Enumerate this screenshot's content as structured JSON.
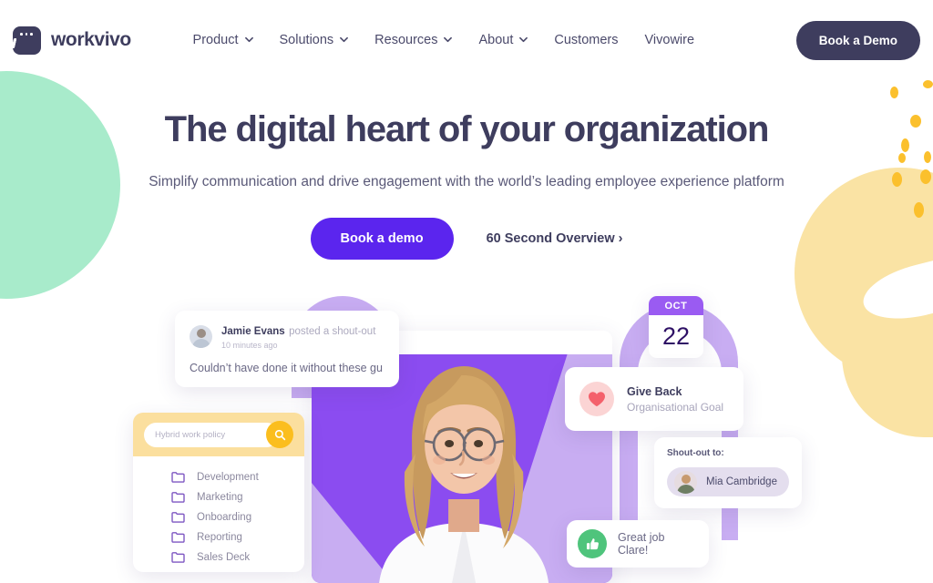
{
  "brand": {
    "name": "workvivo",
    "logo_icon": "workvivo-logo-icon",
    "logo_color": "#3E3D5E"
  },
  "nav": {
    "items": [
      {
        "label": "Product",
        "has_dropdown": true
      },
      {
        "label": "Solutions",
        "has_dropdown": true
      },
      {
        "label": "Resources",
        "has_dropdown": true
      },
      {
        "label": "About",
        "has_dropdown": true
      },
      {
        "label": "Customers",
        "has_dropdown": false
      },
      {
        "label": "Vivowire",
        "has_dropdown": false
      }
    ],
    "cta_label": "Book a Demo",
    "cta_color": "#3E3D5E"
  },
  "hero": {
    "headline": "The digital heart of your organization",
    "subheadline": "Simplify communication and drive engagement with the world’s leading employee experience platform",
    "primary_cta": "Book a demo",
    "primary_cta_color": "#5B25EE",
    "secondary_cta": "60 Second Overview ›"
  },
  "composition": {
    "shoutout_card": {
      "author": "Jamie Evans",
      "action": "posted a shout-out",
      "timestamp": "10 minutes ago",
      "body": "Couldn’t have done it without these gu",
      "avatar_icon": "user-avatar"
    },
    "search_card": {
      "search_placeholder": "Hybrid work policy",
      "search_icon": "search-icon",
      "search_button_color": "#FBBE1E",
      "header_color": "#FBDF9E",
      "folders": [
        {
          "label": "Development",
          "icon": "folder-icon"
        },
        {
          "label": "Marketing",
          "icon": "folder-icon"
        },
        {
          "label": "Onboarding",
          "icon": "folder-icon"
        },
        {
          "label": "Reporting",
          "icon": "folder-icon"
        },
        {
          "label": "Sales Deck",
          "icon": "folder-icon"
        }
      ]
    },
    "calendar_card": {
      "month": "OCT",
      "day": "22",
      "header_color": "#9A5BF2"
    },
    "goal_card": {
      "title": "Give Back",
      "subtitle": "Organisational Goal",
      "icon": "heart-icon",
      "icon_color": "#F4606B",
      "icon_bg": "#FBD4D4"
    },
    "shoutout_to_card": {
      "label": "Shout-out to:",
      "person": "Mia Cambridge",
      "avatar_icon": "user-avatar"
    },
    "praise_card": {
      "message": "Great job Clare!",
      "icon": "thumbs-up-icon",
      "icon_bg": "#4FC47C"
    },
    "portrait_alt": "smiling-woman-portrait",
    "panel_color": "#8B4CF0",
    "accent_color": "#C8ADF2"
  },
  "decor": {
    "mint_color": "#A8EBCB",
    "yellow_color": "#FAE3A4",
    "dot_color": "#FBC02D"
  }
}
